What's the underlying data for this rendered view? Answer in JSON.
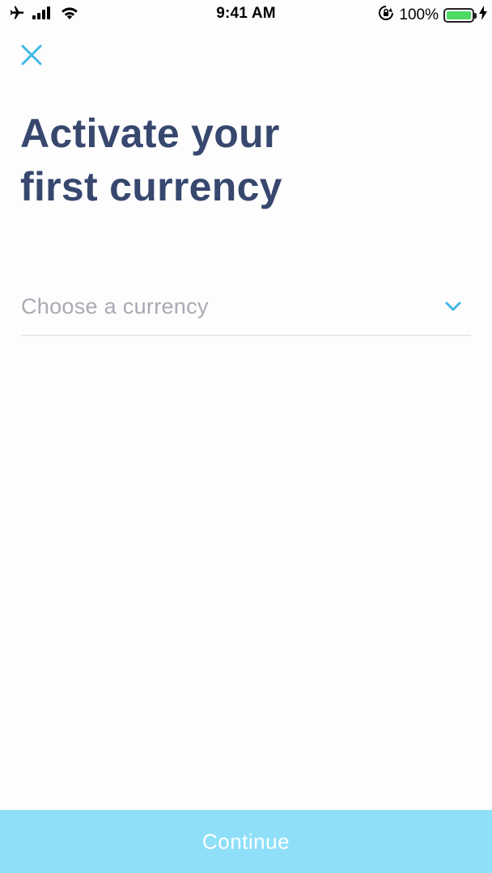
{
  "status_bar": {
    "time": "9:41 AM",
    "battery_percent": "100%",
    "battery_level": 1.0,
    "icons": [
      "airplane-icon",
      "signal-icon",
      "wifi-icon",
      "rotation-lock-icon",
      "battery-icon",
      "charging-icon"
    ]
  },
  "header": {
    "close_icon": "close-icon"
  },
  "title": {
    "line1": "Activate your",
    "line2": "first currency"
  },
  "currency": {
    "placeholder": "Choose a currency",
    "chevron_icon": "chevron-down-icon"
  },
  "footer": {
    "continue_label": "Continue"
  },
  "colors": {
    "title": "#37476e",
    "accent": "#3fb8e6",
    "button_bg": "#8fdff9",
    "placeholder": "#a9abb2",
    "divider": "#e6e7ea",
    "battery": "#4cd964"
  }
}
